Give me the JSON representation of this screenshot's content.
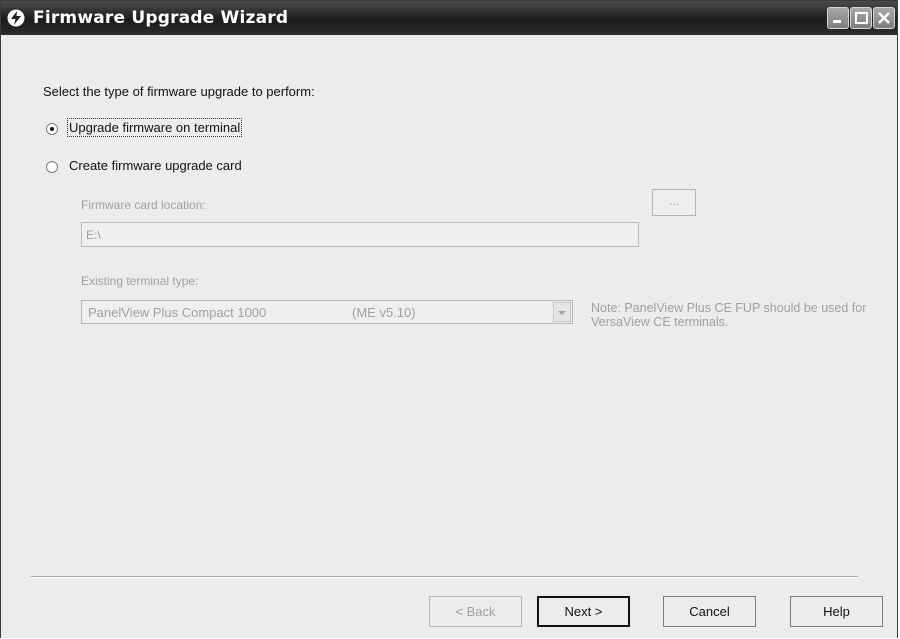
{
  "window": {
    "title": "Firmware Upgrade Wizard",
    "titlebar_color": "#2c2c2c"
  },
  "form": {
    "prompt": "Select the type of firmware upgrade to perform:",
    "options": [
      {
        "label": "Upgrade firmware on terminal",
        "selected": true
      },
      {
        "label": "Create firmware upgrade card",
        "selected": false
      }
    ],
    "card_location": {
      "label": "Firmware card location:",
      "value": "E:\\",
      "browse_label": "..."
    },
    "terminal_type": {
      "label": "Existing terminal type:",
      "model": "PanelView Plus Compact 1000",
      "version": "(ME v5.10)"
    },
    "note": "Note: PanelView Plus CE FUP should be used for VersaView CE terminals."
  },
  "buttons": {
    "back": "< Back",
    "next": "Next >",
    "cancel": "Cancel",
    "help": "Help"
  },
  "icons": [
    "wizard-icon",
    "minimize-icon",
    "maximize-icon",
    "close-icon",
    "dropdown-arrow-icon"
  ]
}
